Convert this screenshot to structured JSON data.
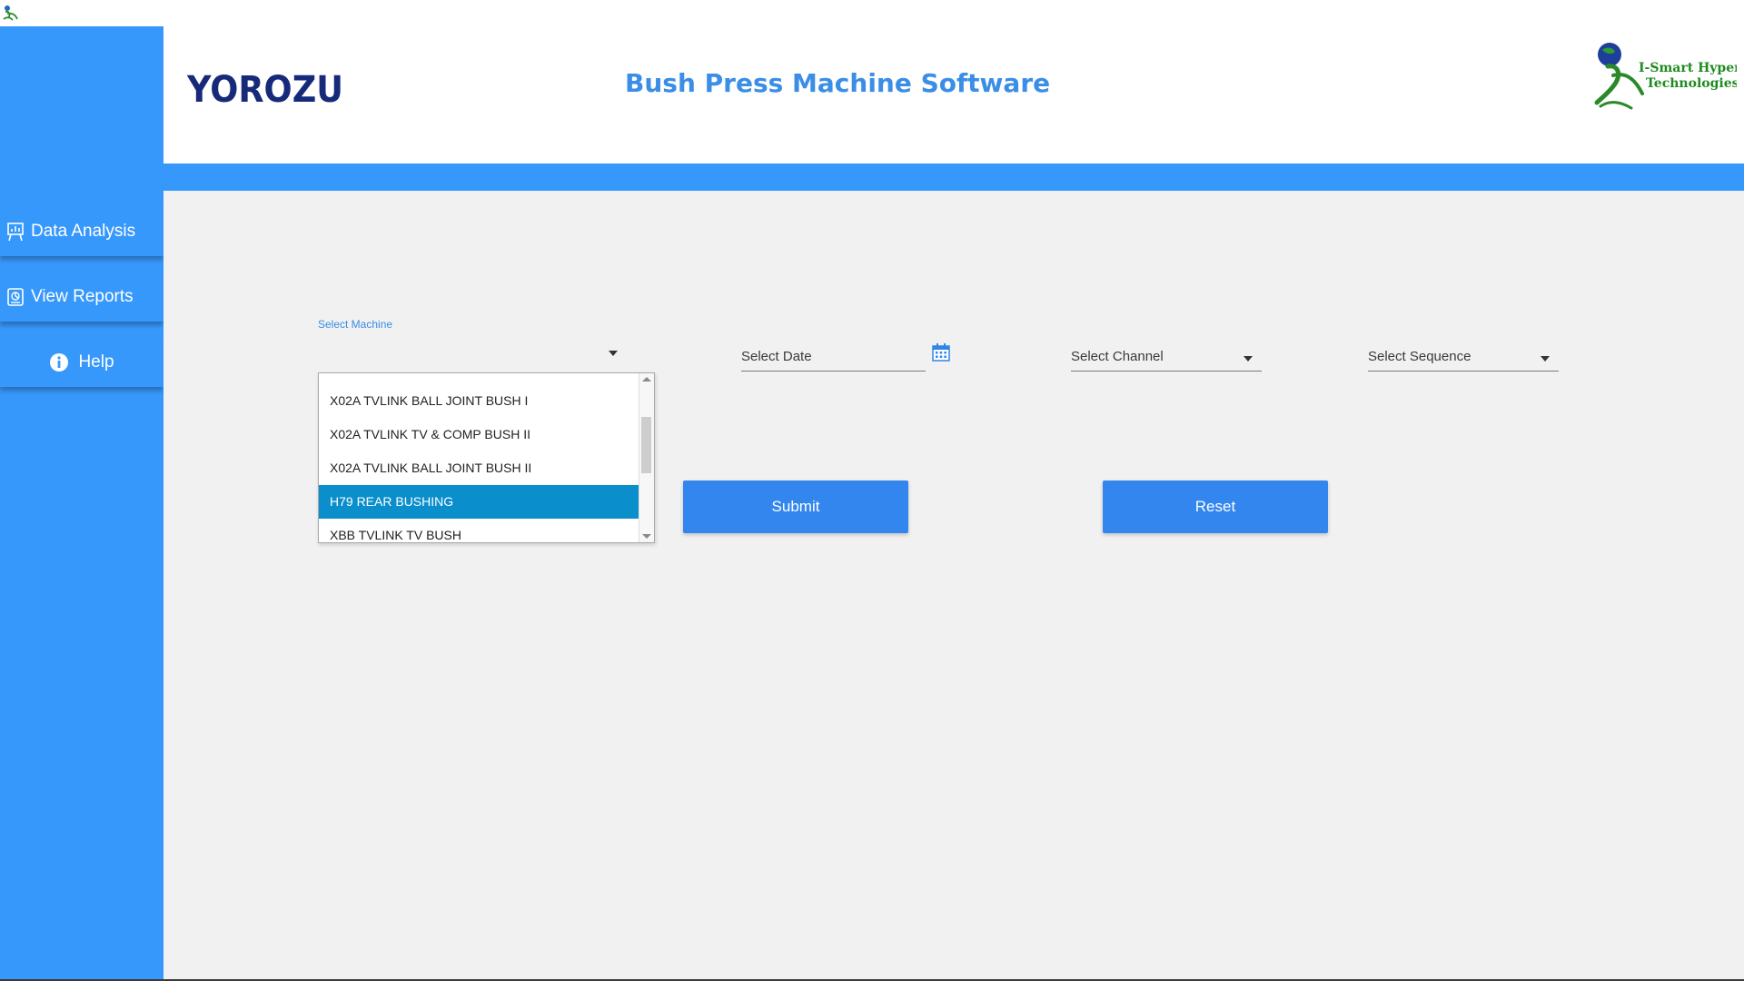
{
  "sidebar": {
    "items": [
      {
        "label": "Data Analysis",
        "icon": "presentation-chart-icon"
      },
      {
        "label": "View Reports",
        "icon": "report-icon"
      },
      {
        "label": "Help",
        "icon": "info-icon"
      }
    ]
  },
  "header": {
    "company_logo_text": "YOROZU",
    "app_title": "Bush Press Machine Software",
    "partner_logo_text_line1": "I-Smart Hyper",
    "partner_logo_text_line2": "Technologies"
  },
  "form": {
    "machine": {
      "label": "Select Machine",
      "value": ""
    },
    "date": {
      "placeholder": "Select Date"
    },
    "channel": {
      "placeholder": "Select Channel"
    },
    "sequence": {
      "placeholder": "Select Sequence"
    }
  },
  "dropdown": {
    "options": [
      "X02A TVLINK BALL JOINT BUSH I",
      "X02A TVLINK TV & COMP BUSH II",
      "X02A TVLINK BALL JOINT BUSH II",
      "H79 REAR BUSHING",
      "XBB TVLINK TV BUSH"
    ],
    "selected": "H79 REAR BUSHING"
  },
  "buttons": {
    "submit": "Submit",
    "reset": "Reset"
  },
  "colors": {
    "sidebar": "#3798fb",
    "accent": "#3386ee",
    "title": "#3a8ee6",
    "selection": "#0a8fcc"
  }
}
